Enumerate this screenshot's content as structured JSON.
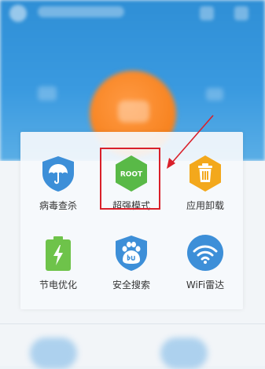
{
  "menu": {
    "items": [
      {
        "label": "病毒查杀",
        "icon": "antivirus-shield-umbrella-icon",
        "color": "#3d8fd8"
      },
      {
        "label": "超强模式",
        "icon": "root-hexagon-icon",
        "icon_text": "ROOT",
        "color": "#59b947",
        "highlighted": true
      },
      {
        "label": "应用卸载",
        "icon": "trash-hexagon-icon",
        "color": "#f3a81c"
      },
      {
        "label": "节电优化",
        "icon": "battery-charging-icon",
        "color": "#6ec34a"
      },
      {
        "label": "安全搜索",
        "icon": "baidu-paw-shield-icon",
        "color": "#3d8fd8"
      },
      {
        "label": "WiFi雷达",
        "icon": "wifi-radar-icon",
        "color": "#3d8fd8"
      }
    ]
  },
  "annotation": {
    "highlight_color": "#d9202a"
  }
}
